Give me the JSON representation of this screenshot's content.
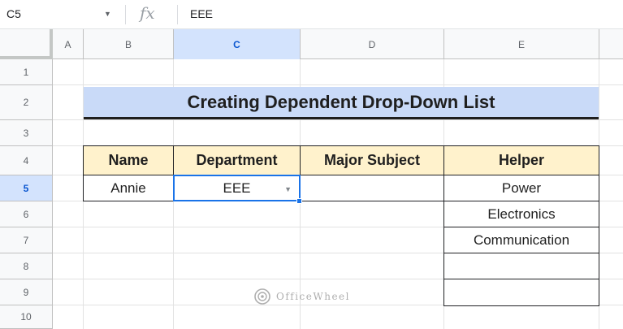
{
  "formula_bar": {
    "name_box": "C5",
    "fx_symbol": "fx",
    "value": "EEE"
  },
  "column_headers": [
    "A",
    "B",
    "C",
    "D",
    "E"
  ],
  "active_column": "C",
  "row_headers": [
    "1",
    "2",
    "3",
    "4",
    "5",
    "6",
    "7",
    "8",
    "9",
    "10"
  ],
  "active_row": "5",
  "sheet": {
    "title": "Creating Dependent Drop-Down List",
    "table": {
      "headers": [
        "Name",
        "Department",
        "Major Subject",
        "Helper"
      ],
      "row": {
        "name": "Annie",
        "department": "EEE",
        "major_subject": ""
      },
      "helper_values": [
        "Power",
        "Electronics",
        "Communication",
        "",
        ""
      ]
    }
  },
  "colors": {
    "title_fill": "#c9daf8",
    "header_fill": "#fff2cc",
    "selection": "#1a73e8"
  },
  "watermark": {
    "text": "OfficeWheel"
  }
}
